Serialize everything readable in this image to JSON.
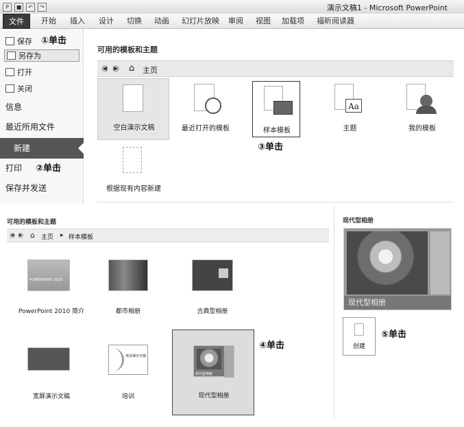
{
  "window": {
    "title": "演示文稿1 - Microsoft PowerPoint"
  },
  "quick_access": {
    "app": "P",
    "save": "■",
    "undo": "↶",
    "redo": "↷"
  },
  "ribbon": {
    "tabs": [
      "文件",
      "开始",
      "插入",
      "设计",
      "切换",
      "动画",
      "幻灯片放映",
      "审阅",
      "视图",
      "加载项",
      "福昕阅读器"
    ]
  },
  "left_menu": {
    "save": "保存",
    "save_as": "另存为",
    "open": "打开",
    "close": "关闭",
    "info": "信息",
    "recent": "最近所用文件",
    "new": "新建",
    "print": "打印",
    "save_send": "保存并发送"
  },
  "steps": {
    "s1": "①单击",
    "s2": "②单击",
    "s3": "③单击",
    "s4": "④单击",
    "s5": "⑤单击"
  },
  "top_panel": {
    "title": "可用的模板和主题",
    "nav": {
      "back": "◀",
      "forward": "▶",
      "home_label": "主页"
    },
    "items": [
      "空白演示文稿",
      "最近打开的模板",
      "样本模板",
      "主题",
      "我的模板",
      "根据现有内容新建"
    ]
  },
  "bottom_panel": {
    "title": "可用的模板和主题",
    "breadcrumb": [
      "主页",
      "样本模板"
    ],
    "templates": [
      "PowerPoint 2010 简介",
      "都市相册",
      "古典型相册",
      "宽屏演示文稿",
      "培训",
      "现代型相册"
    ],
    "thumb_text": {
      "intro": "POWERPOINT 2010",
      "train": "培训演示文稿",
      "modern": "现代型相册"
    }
  },
  "preview": {
    "title": "现代型相册",
    "caption": "现代型相册",
    "create_label": "创建"
  }
}
